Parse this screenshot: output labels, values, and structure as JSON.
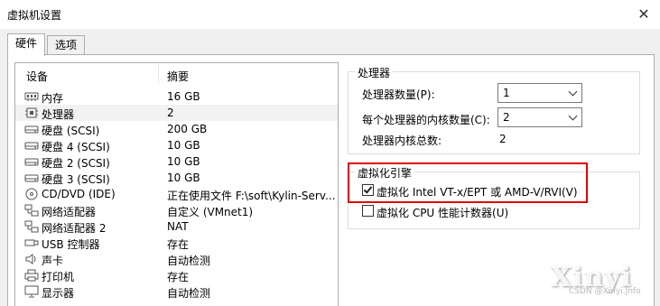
{
  "window": {
    "title": "虚拟机设置",
    "close_glyph": "✕"
  },
  "tabs": [
    {
      "label": "硬件"
    },
    {
      "label": "选项"
    }
  ],
  "device_list": {
    "col_device": "设备",
    "col_summary": "摘要",
    "rows": [
      {
        "name": "内存",
        "summary": "16 GB",
        "icon": "memory-icon"
      },
      {
        "name": "处理器",
        "summary": "2",
        "icon": "processor-icon",
        "selected": true
      },
      {
        "name": "硬盘 (SCSI)",
        "summary": "200 GB",
        "icon": "hard-disk-icon"
      },
      {
        "name": "硬盘 4 (SCSI)",
        "summary": "10 GB",
        "icon": "hard-disk-icon"
      },
      {
        "name": "硬盘 2 (SCSI)",
        "summary": "10 GB",
        "icon": "hard-disk-icon"
      },
      {
        "name": "硬盘 3 (SCSI)",
        "summary": "10 GB",
        "icon": "hard-disk-icon"
      },
      {
        "name": "CD/DVD (IDE)",
        "summary": "正在使用文件 F:\\soft\\Kylin-Serv...",
        "icon": "cd-dvd-icon"
      },
      {
        "name": "网络适配器",
        "summary": "自定义 (VMnet1)",
        "icon": "network-adapter-icon"
      },
      {
        "name": "网络适配器 2",
        "summary": "NAT",
        "icon": "network-adapter-icon"
      },
      {
        "name": "USB 控制器",
        "summary": "存在",
        "icon": "usb-icon"
      },
      {
        "name": "声卡",
        "summary": "自动检测",
        "icon": "sound-card-icon"
      },
      {
        "name": "打印机",
        "summary": "存在",
        "icon": "printer-icon"
      },
      {
        "name": "显示器",
        "summary": "自动检测",
        "icon": "display-icon"
      }
    ]
  },
  "processor": {
    "group_title": "处理器",
    "count_label": "处理器数量(P):",
    "count_value": "1",
    "cores_label": "每个处理器的内核数量(C):",
    "cores_value": "2",
    "total_label": "处理器内核总数:",
    "total_value": "2"
  },
  "virtualization": {
    "group_title": "虚拟化引擎",
    "vtx_label": "虚拟化 Intel VT-x/EPT 或 AMD-V/RVI(V)",
    "vtx_checked": true,
    "cpu_counter_label": "虚拟化 CPU 性能计数器(U)",
    "cpu_counter_checked": false
  },
  "watermark": {
    "text": "Xinyi",
    "sub": "CSDN @Xinyi.Jnfo"
  }
}
